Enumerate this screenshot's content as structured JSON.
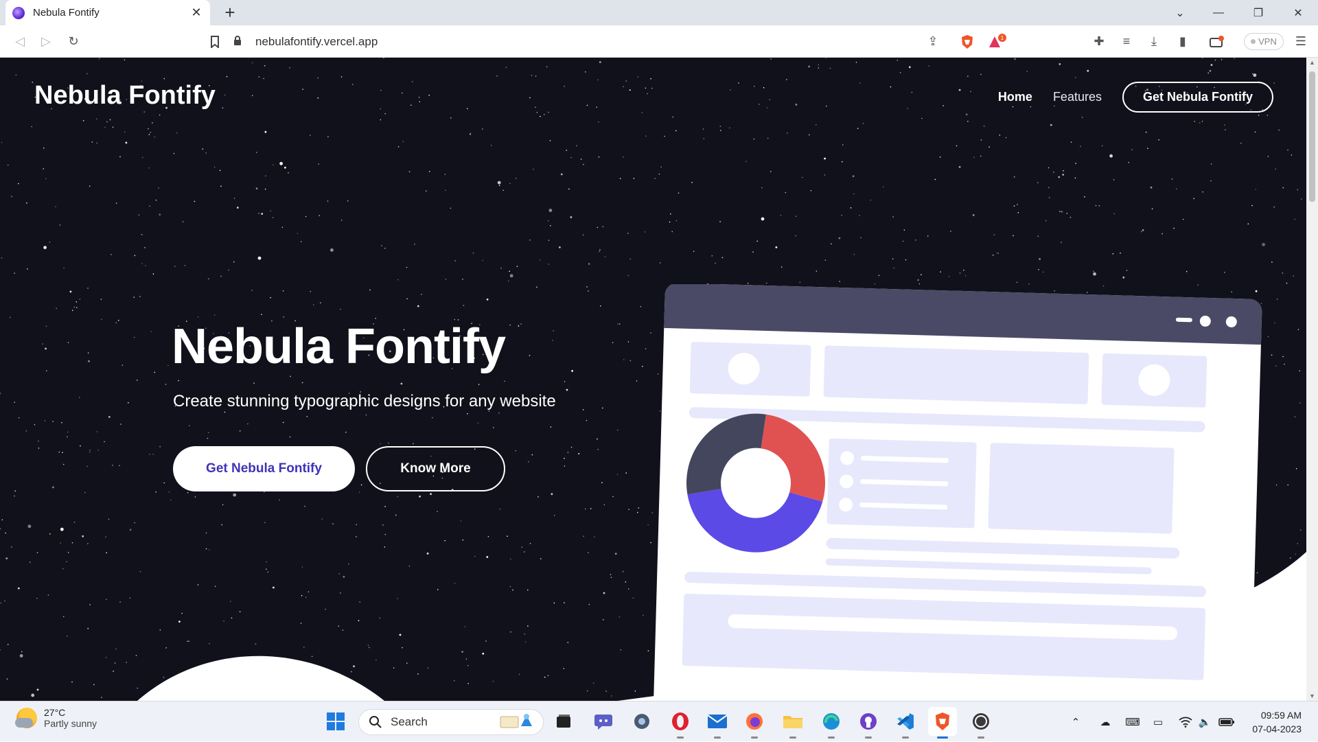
{
  "browser": {
    "tab_title": "Nebula Fontify",
    "url": "nebulafontify.vercel.app",
    "vpn_label": "VPN",
    "alert_badge": "1"
  },
  "site": {
    "brand": "Nebula Fontify",
    "nav": {
      "home": "Home",
      "features": "Features",
      "cta": "Get Nebula Fontify"
    },
    "hero": {
      "title": "Nebula Fontify",
      "subtitle": "Create stunning typographic designs for any website",
      "primary_button": "Get Nebula Fontify",
      "secondary_button": "Know More"
    },
    "illustration": {
      "donut": [
        {
          "name": "red",
          "fraction": 0.27,
          "color": "#e05252"
        },
        {
          "name": "purple",
          "fraction": 0.43,
          "color": "#5b4ae6"
        },
        {
          "name": "slate",
          "fraction": 0.3,
          "color": "#44465e"
        }
      ]
    }
  },
  "colors": {
    "page_bg": "#10111a",
    "accent": "#3e33b8",
    "card_bg": "#ffffff",
    "card_header": "#4a4a66",
    "placeholder": "#e7e8fb"
  },
  "taskbar": {
    "weather_temp": "27°C",
    "weather_condition": "Partly sunny",
    "search_placeholder": "Search",
    "time": "09:59 AM",
    "date": "07-04-2023"
  }
}
